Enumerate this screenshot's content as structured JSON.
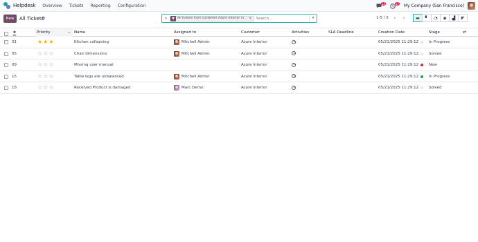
{
  "nav": {
    "app_name": "Helpdesk",
    "items": [
      "Overview",
      "Tickets",
      "Reporting",
      "Configuration"
    ],
    "messages_count": "23",
    "activities_count": "57",
    "company": "My Company (San Francisco)"
  },
  "control": {
    "new_label": "New",
    "breadcrumb": "All Tickets",
    "facet_text": "All tickets from customer Azure Interior in...",
    "search_placeholder": "Search...",
    "pager": "1-5 / 5"
  },
  "columns": {
    "priority": "Priority",
    "name": "Name",
    "assigned": "Assigned to",
    "customer": "Customer",
    "activities": "Activities",
    "sla": "SLA Deadline",
    "created": "Creation Date",
    "stage": "Stage"
  },
  "colors": {
    "brand": "#714b67",
    "accent": "#2bb0a6",
    "star": "#f3b100",
    "stage_red": "#e11d48",
    "stage_green": "#16a34a"
  },
  "rows": [
    {
      "id": "01",
      "priority": 3,
      "name": "Kitchen collapsing",
      "assigned": "Mitchell Admin",
      "avatar": "mitchell",
      "customer": "Azure Interior",
      "created": "05/21/2025 11:29:12",
      "stage": "In Progress",
      "dot": ""
    },
    {
      "id": "05",
      "priority": 0,
      "name": "Chair dimensions",
      "assigned": "Mitchell Admin",
      "avatar": "mitchell",
      "customer": "Azure Interior",
      "created": "05/21/2025 11:29:12",
      "stage": "Solved",
      "dot": ""
    },
    {
      "id": "09",
      "priority": 0,
      "name": "Missing user manual",
      "assigned": "",
      "avatar": "",
      "customer": "Azure Interior",
      "created": "05/21/2025 11:29:12",
      "stage": "New",
      "dot": "red"
    },
    {
      "id": "15",
      "priority": 0,
      "name": "Table legs are unbalanced",
      "assigned": "Mitchell Admin",
      "avatar": "mitchell",
      "customer": "Azure Interior",
      "created": "05/21/2025 11:29:12",
      "stage": "In Progress",
      "dot": "green"
    },
    {
      "id": "18",
      "priority": 0,
      "name": "Received Product is damaged",
      "assigned": "Marc Demo",
      "avatar": "marc",
      "customer": "Azure Interior",
      "created": "05/21/2025 11:29:12",
      "stage": "Solved",
      "dot": ""
    }
  ]
}
